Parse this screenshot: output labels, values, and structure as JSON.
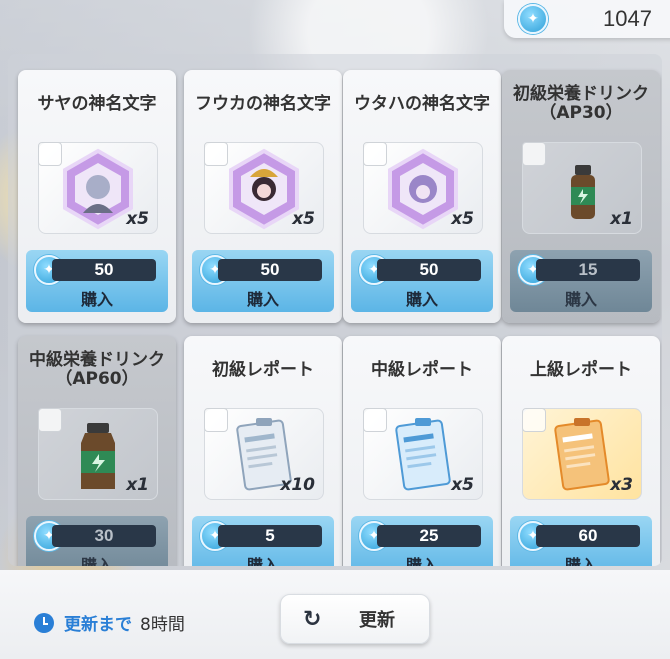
{
  "currency": {
    "icon": "coin-icon",
    "amount": "1047"
  },
  "items": [
    {
      "title": "サヤの神名文字",
      "qty": "x5",
      "price": "50",
      "buy_label": "購入",
      "icon": "hexagon-character-badge-icon",
      "dimmed": false
    },
    {
      "title": "フウカの神名文字",
      "qty": "x5",
      "price": "50",
      "buy_label": "購入",
      "icon": "hexagon-character-badge-icon",
      "dimmed": false
    },
    {
      "title": "ウタハの神名文字",
      "qty": "x5",
      "price": "50",
      "buy_label": "購入",
      "icon": "hexagon-character-badge-icon",
      "dimmed": false
    },
    {
      "title": "初級栄養ドリンク（AP30）",
      "qty": "x1",
      "price": "15",
      "buy_label": "購入",
      "icon": "energy-drink-icon",
      "dimmed": true
    },
    {
      "title": "中級栄養ドリンク（AP60）",
      "qty": "x1",
      "price": "30",
      "buy_label": "購入",
      "icon": "energy-drink-icon",
      "dimmed": true
    },
    {
      "title": "初級レポート",
      "qty": "x10",
      "price": "5",
      "buy_label": "購入",
      "icon": "report-clipboard-icon",
      "dimmed": false
    },
    {
      "title": "中級レポート",
      "qty": "x5",
      "price": "25",
      "buy_label": "購入",
      "icon": "report-clipboard-icon",
      "dimmed": false
    },
    {
      "title": "上級レポート",
      "qty": "x3",
      "price": "60",
      "buy_label": "購入",
      "icon": "report-clipboard-icon",
      "dimmed": false
    }
  ],
  "footer": {
    "refresh_label": "更新まで",
    "refresh_time": "8時間",
    "refresh_button": "更新"
  },
  "colors": {
    "accent": "#5cb5e6",
    "price_bar": "#293748",
    "clock": "#2a7fd6"
  }
}
